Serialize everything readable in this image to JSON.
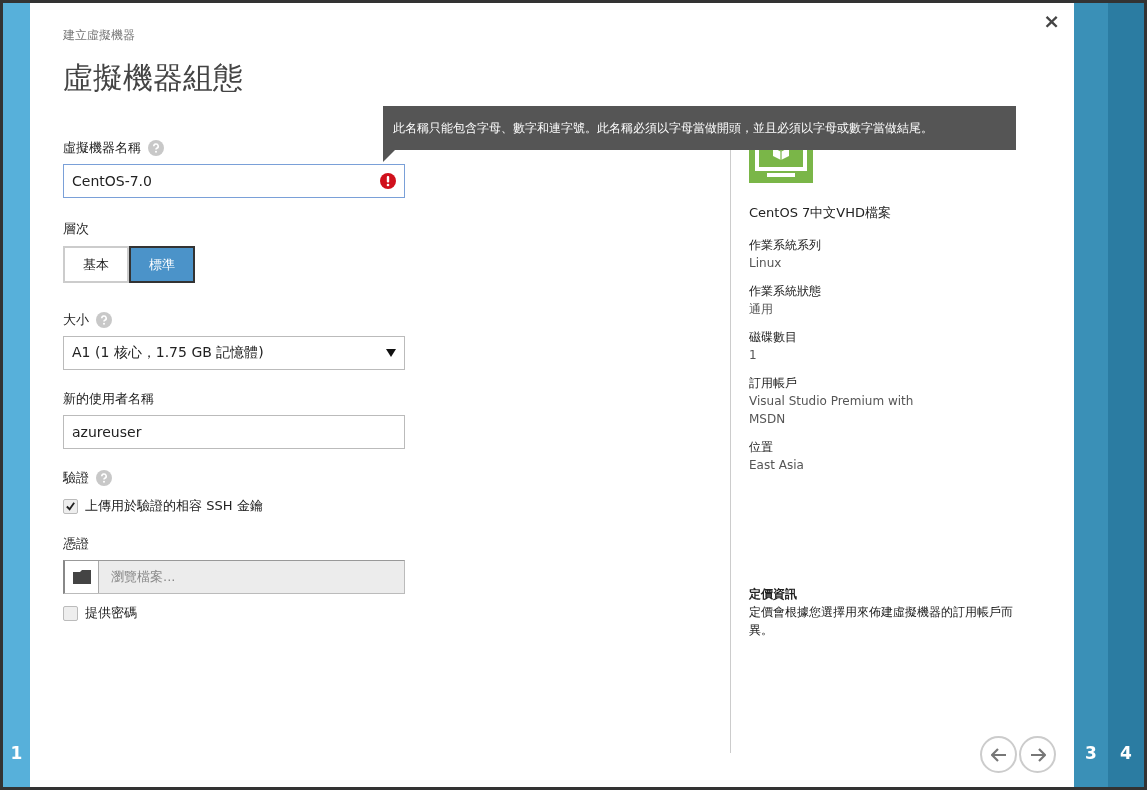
{
  "steps_left": [
    {
      "label": "1"
    }
  ],
  "steps_right": [
    {
      "label": "3"
    },
    {
      "label": "4"
    }
  ],
  "breadcrumb": "建立虛擬機器",
  "title": "虛擬機器組態",
  "close": "×",
  "tooltip": "此名稱只能包含字母、數字和連字號。此名稱必須以字母當做開頭，並且必須以字母或數字當做結尾。",
  "name_field": {
    "label": "虛擬機器名稱",
    "value": "CentOS-7.0",
    "error": true
  },
  "tier": {
    "label": "層次",
    "options": [
      {
        "label": "基本",
        "selected": false
      },
      {
        "label": "標準",
        "selected": true
      }
    ]
  },
  "size": {
    "label": "大小",
    "value": "A1 (1 核心，1.75 GB 記憶體)"
  },
  "username": {
    "label": "新的使用者名稱",
    "value": "azureuser"
  },
  "auth": {
    "label": "驗證",
    "options": [
      {
        "label": "上傳用於驗證的相容 SSH 金鑰",
        "checked": true
      }
    ]
  },
  "certificate": {
    "label": "憑證",
    "placeholder": "瀏覽檔案..."
  },
  "password_option": {
    "label": "提供密碼",
    "checked": false
  },
  "image": {
    "description": "CentOS 7中文VHD檔案"
  },
  "details": [
    {
      "label": "作業系統系列",
      "value": "Linux"
    },
    {
      "label": "作業系統狀態",
      "value": "通用"
    },
    {
      "label": "磁碟數目",
      "value": "1"
    },
    {
      "label": "訂用帳戶",
      "value": "Visual Studio Premium with MSDN"
    },
    {
      "label": "位置",
      "value": "East Asia"
    }
  ],
  "pricing": {
    "title": "定價資訊",
    "text": "定價會根據您選擇用來佈建虛擬機器的訂用帳戶而異。"
  }
}
